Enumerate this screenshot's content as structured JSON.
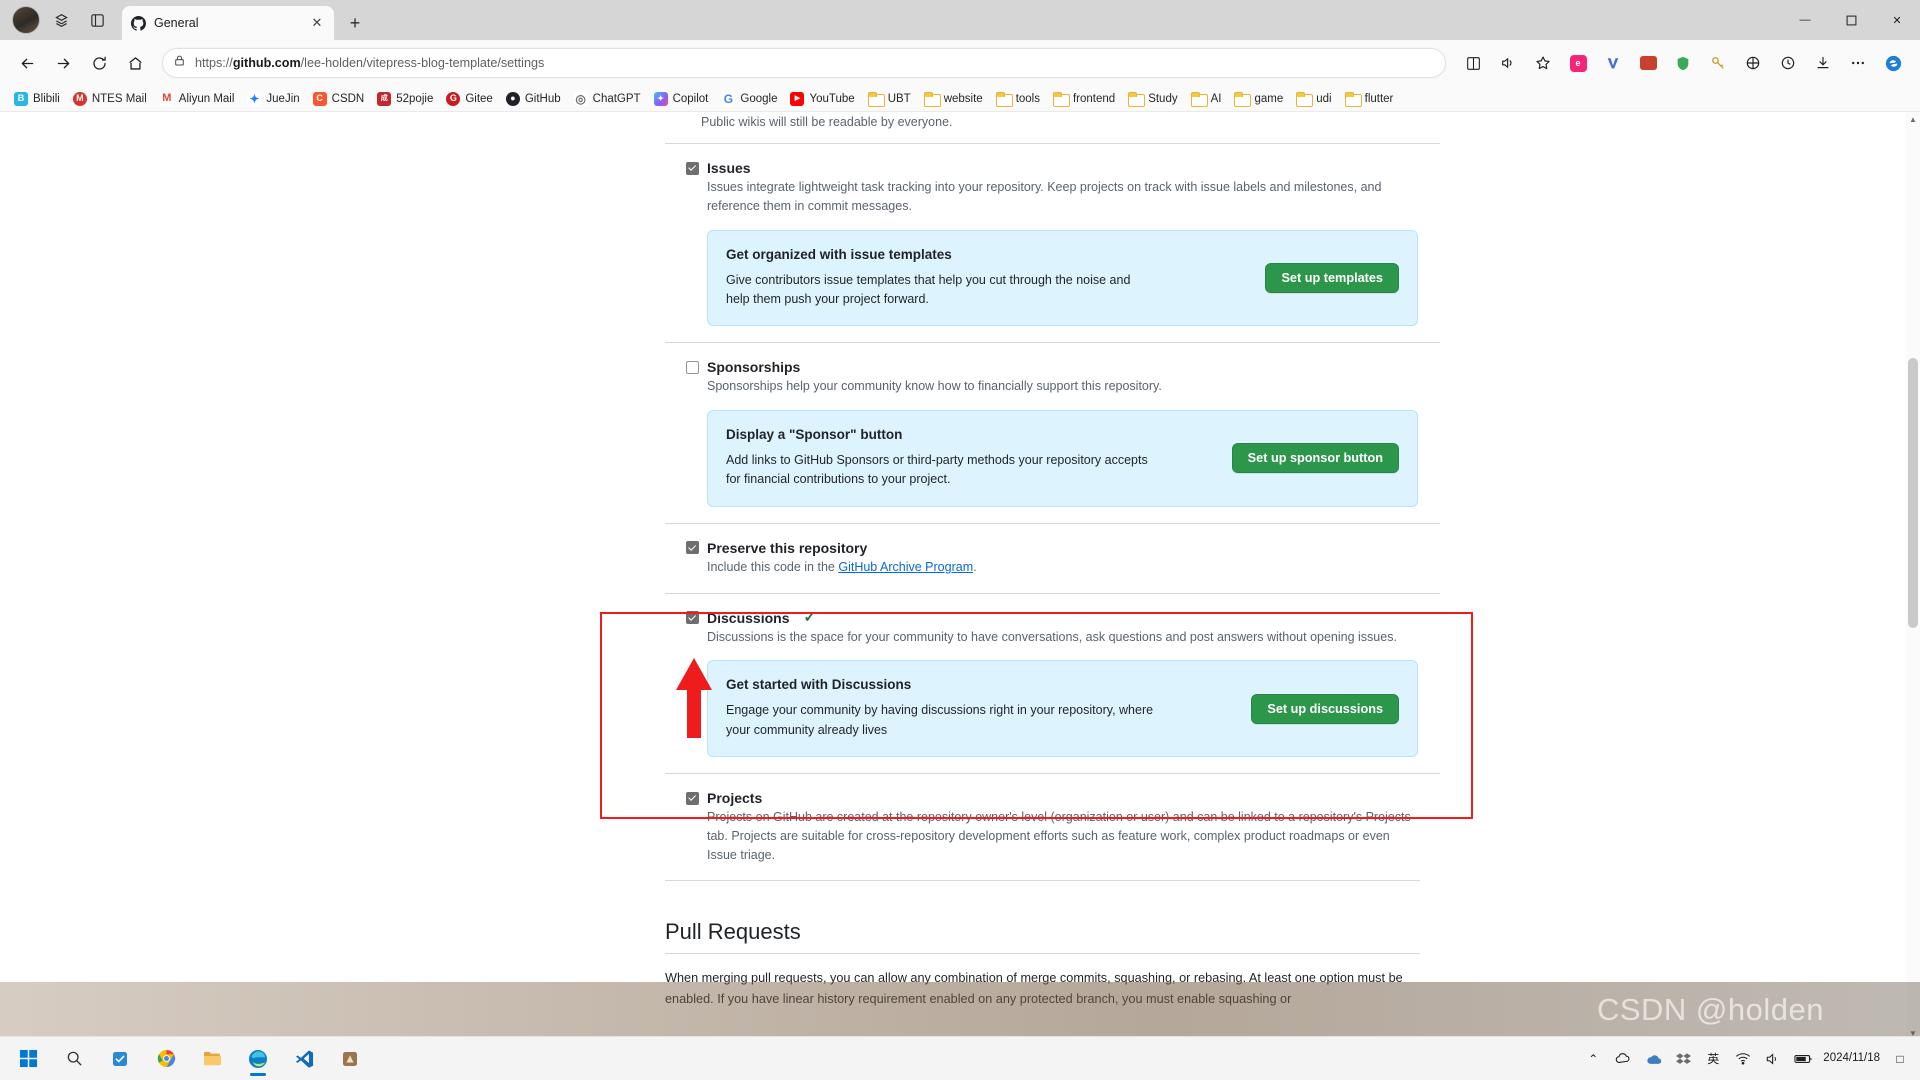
{
  "browser": {
    "tab": {
      "title": "General",
      "close_label": "✕"
    },
    "newtab_label": "+",
    "window_controls": {
      "minimize": "—",
      "maximize": "❐",
      "close": "✕"
    },
    "url_prefix": "https://",
    "url_host": "github.com",
    "url_path": "/lee-holden/vitepress-blog-template/settings",
    "url_full": "https://github.com/lee-holden/vitepress-blog-template/settings",
    "nav": {
      "back": "back-arrow",
      "forward": "forward-arrow",
      "refresh": "reload",
      "home": "home"
    },
    "toolbar_right": [
      "split-screen-icon",
      "read-aloud-icon",
      "favorite-star-icon",
      "extension-pink-icon",
      "v-icon",
      "wallet-icon",
      "shield-icon",
      "key-icon",
      "browser-essentials-icon",
      "history-icon",
      "downloads-icon",
      "settings-more-icon",
      "copilot-icon"
    ],
    "bookmarks": [
      {
        "label": "Blibili",
        "icon": "bilibili",
        "color": "#2ab6e4",
        "glyph": "B",
        "type": "site"
      },
      {
        "label": "NTES Mail",
        "icon": "netease-mail",
        "color": "#d9332e",
        "glyph": "M",
        "type": "site"
      },
      {
        "label": "Aliyun Mail",
        "icon": "aliyun-mail",
        "color": "#ea4335",
        "glyph": "M",
        "type": "site"
      },
      {
        "label": "JueJin",
        "icon": "juejin",
        "color": "#1e80ff",
        "glyph": "J",
        "type": "site"
      },
      {
        "label": "CSDN",
        "icon": "csdn",
        "color": "#fc5531",
        "glyph": "C",
        "type": "site"
      },
      {
        "label": "52pojie",
        "icon": "52pojie",
        "color": "#c1272d",
        "glyph": "5",
        "type": "site"
      },
      {
        "label": "Gitee",
        "icon": "gitee",
        "color": "#c71d23",
        "glyph": "G",
        "type": "site"
      },
      {
        "label": "GitHub",
        "icon": "github",
        "color": "#1f2328",
        "glyph": "●",
        "type": "site"
      },
      {
        "label": "ChatGPT",
        "icon": "chatgpt",
        "color": "#6e6e6e",
        "glyph": "◎",
        "type": "site"
      },
      {
        "label": "Copilot",
        "icon": "copilot",
        "color": "#7b5cf0",
        "glyph": "✦",
        "type": "site"
      },
      {
        "label": "Google",
        "icon": "google",
        "color": "#4285f4",
        "glyph": "G",
        "type": "site"
      },
      {
        "label": "YouTube",
        "icon": "youtube",
        "color": "#ff0000",
        "glyph": "▶",
        "type": "site"
      },
      {
        "label": "UBT",
        "icon": "folder",
        "type": "folder"
      },
      {
        "label": "website",
        "icon": "folder",
        "type": "folder"
      },
      {
        "label": "tools",
        "icon": "folder",
        "type": "folder"
      },
      {
        "label": "frontend",
        "icon": "folder",
        "type": "folder"
      },
      {
        "label": "Study",
        "icon": "folder",
        "type": "folder"
      },
      {
        "label": "AI",
        "icon": "folder",
        "type": "folder"
      },
      {
        "label": "game",
        "icon": "folder",
        "type": "folder"
      },
      {
        "label": "udi",
        "icon": "folder",
        "type": "folder"
      },
      {
        "label": "flutter",
        "icon": "folder",
        "type": "folder"
      }
    ]
  },
  "page": {
    "partial_top_text": "Public wikis will still be readable by everyone.",
    "features": [
      {
        "key": "issues",
        "label": "Issues",
        "checked": true,
        "verified": false,
        "description": "Issues integrate lightweight task tracking into your repository. Keep projects on track with issue labels and milestones, and reference them in commit messages.",
        "promo": {
          "title": "Get organized with issue templates",
          "body": "Give contributors issue templates that help you cut through the noise and help them push your project forward.",
          "button": "Set up templates"
        }
      },
      {
        "key": "sponsorships",
        "label": "Sponsorships",
        "checked": false,
        "verified": false,
        "description": "Sponsorships help your community know how to financially support this repository.",
        "promo": {
          "title": "Display a \"Sponsor\" button",
          "body": "Add links to GitHub Sponsors or third-party methods your repository accepts for financial contributions to your project.",
          "button": "Set up sponsor button"
        }
      },
      {
        "key": "preserve-this-repository",
        "label": "Preserve this repository",
        "checked": true,
        "verified": false,
        "description_prefix": "Include this code in the ",
        "description_link": "GitHub Archive Program",
        "description_suffix": ".",
        "promo": null
      },
      {
        "key": "discussions",
        "label": "Discussions",
        "checked": true,
        "verified": true,
        "verified_glyph": "✓",
        "description": "Discussions is the space for your community to have conversations, ask questions and post answers without opening issues.",
        "promo": {
          "title": "Get started with Discussions",
          "body": "Engage your community by having discussions right in your repository, where your community already lives",
          "button": "Set up discussions"
        }
      },
      {
        "key": "projects",
        "label": "Projects",
        "checked": true,
        "verified": false,
        "description": "Projects on GitHub are created at the repository owner's level (organization or user) and can be linked to a repository's Projects tab. Projects are suitable for cross-repository development efforts such as feature work, complex product roadmaps or even Issue triage.",
        "promo": null
      }
    ],
    "pull_requests": {
      "heading": "Pull Requests",
      "paragraph": "When merging pull requests, you can allow any combination of merge commits, squashing, or rebasing. At least one option must be enabled. If you have linear history requirement enabled on any protected branch, you must enable squashing or"
    }
  },
  "annotation": {
    "box_color": "#ee1c1c",
    "arrow_color": "#ee1c1c",
    "arrow_points_to": "discussions-checkbox"
  },
  "taskbar": {
    "items": [
      {
        "name": "start-windows-icon",
        "glyph": "⊞",
        "color": "#0078d4"
      },
      {
        "name": "search-icon",
        "glyph": "⚲",
        "color": "#333"
      },
      {
        "name": "todo-icon",
        "glyph": "✓",
        "color": "#2b88d8"
      },
      {
        "name": "chrome-icon",
        "glyph": "◉",
        "color": "#4285f4"
      },
      {
        "name": "file-explorer-icon",
        "glyph": "▤",
        "color": "#e8a33d"
      },
      {
        "name": "edge-icon",
        "glyph": "◔",
        "color": "#0f7ec8"
      },
      {
        "name": "vscode-icon",
        "glyph": "❰❱",
        "color": "#0f6cbd"
      },
      {
        "name": "app-icon",
        "glyph": "▣",
        "color": "#8c6a4a"
      }
    ],
    "tray": {
      "chevron": "⌃",
      "icons": [
        "cloud-icon",
        "battery-icon",
        "network-icon",
        "volume-icon"
      ],
      "ime": "英",
      "date": "2024/11/18",
      "time": "",
      "notification": "□"
    }
  },
  "watermark": {
    "text": "CSDN @holden"
  }
}
